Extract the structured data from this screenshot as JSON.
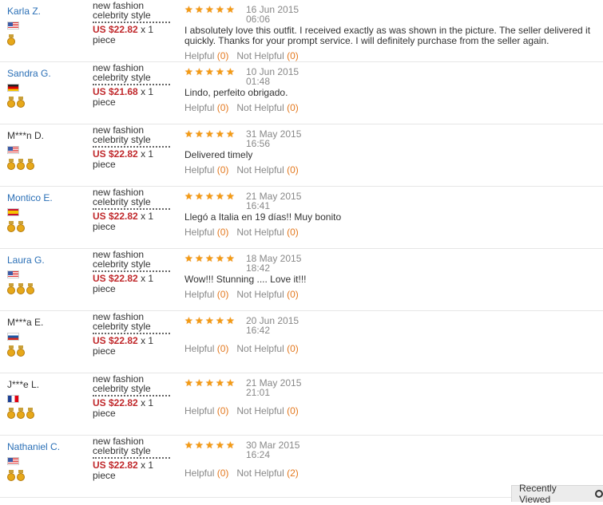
{
  "reviews": [
    {
      "name": "Karla Z.",
      "name_link": true,
      "flag": "us",
      "medals": 1,
      "product": "new fashion celebrity style",
      "price": "US $22.82",
      "qty": "x 1 piece",
      "stars": 5,
      "date": "16 Jun 2015",
      "time": "06:06",
      "comment": "I absolutely love this outfit. I received exactly as was shown in the picture. The seller delivered it quickly. Thanks for your prompt service. I will definitely purchase from the seller again.",
      "helpful": "Helpful",
      "helpful_count": "(0)",
      "not_helpful": "Not Helpful",
      "not_helpful_count": "(0)"
    },
    {
      "name": "Sandra G.",
      "name_link": true,
      "flag": "de",
      "medals": 2,
      "product": "new fashion celebrity style",
      "price": "US $21.68",
      "qty": "x 1 piece",
      "stars": 5,
      "date": "10 Jun 2015",
      "time": "01:48",
      "comment": "Lindo, perfeito obrigado.",
      "helpful": "Helpful",
      "helpful_count": "(0)",
      "not_helpful": "Not Helpful",
      "not_helpful_count": "(0)"
    },
    {
      "name": "M***n D.",
      "name_link": false,
      "flag": "us",
      "medals": 3,
      "product": "new fashion celebrity style",
      "price": "US $22.82",
      "qty": "x 1 piece",
      "stars": 5,
      "date": "31 May 2015",
      "time": "16:56",
      "comment": "Delivered timely",
      "helpful": "Helpful",
      "helpful_count": "(0)",
      "not_helpful": "Not Helpful",
      "not_helpful_count": "(0)"
    },
    {
      "name": "Montico E.",
      "name_link": true,
      "flag": "es",
      "medals": 2,
      "product": "new fashion celebrity style",
      "price": "US $22.82",
      "qty": "x 1 piece",
      "stars": 5,
      "date": "21 May 2015",
      "time": "16:41",
      "comment": "Llegó a Italia en 19 días!! Muy bonito",
      "helpful": "Helpful",
      "helpful_count": "(0)",
      "not_helpful": "Not Helpful",
      "not_helpful_count": "(0)"
    },
    {
      "name": "Laura G.",
      "name_link": true,
      "flag": "us",
      "medals": 3,
      "product": "new fashion celebrity style",
      "price": "US $22.82",
      "qty": "x 1 piece",
      "stars": 5,
      "date": "18 May 2015",
      "time": "18:42",
      "comment": "Wow!!! Stunning .... Love it!!!",
      "helpful": "Helpful",
      "helpful_count": "(0)",
      "not_helpful": "Not Helpful",
      "not_helpful_count": "(0)"
    },
    {
      "name": "M***a E.",
      "name_link": false,
      "flag": "ru",
      "medals": 2,
      "product": "new fashion celebrity style",
      "price": "US $22.82",
      "qty": "x 1 piece",
      "stars": 5,
      "date": "20 Jun 2015",
      "time": "16:42",
      "comment": "",
      "helpful": "Helpful",
      "helpful_count": "(0)",
      "not_helpful": "Not Helpful",
      "not_helpful_count": "(0)"
    },
    {
      "name": "J***e L.",
      "name_link": false,
      "flag": "fr",
      "medals": 3,
      "product": "new fashion celebrity style",
      "price": "US $22.82",
      "qty": "x 1 piece",
      "stars": 5,
      "date": "21 May 2015",
      "time": "21:01",
      "comment": "",
      "helpful": "Helpful",
      "helpful_count": "(0)",
      "not_helpful": "Not Helpful",
      "not_helpful_count": "(0)"
    },
    {
      "name": "Nathaniel C.",
      "name_link": true,
      "flag": "us",
      "medals": 2,
      "product": "new fashion celebrity style",
      "price": "US $22.82",
      "qty": "x 1 piece",
      "stars": 5,
      "date": "30 Mar 2015",
      "time": "16:24",
      "comment": "",
      "helpful": "Helpful",
      "helpful_count": "(0)",
      "not_helpful": "Not Helpful",
      "not_helpful_count": "(2)"
    }
  ],
  "recently_viewed": {
    "label": "Recently Viewed",
    "icon": "chevron-circle-icon"
  },
  "colors": {
    "link": "#2a6fb6",
    "price": "#c0282b",
    "star": "#f39b12",
    "count": "#e4791f"
  }
}
